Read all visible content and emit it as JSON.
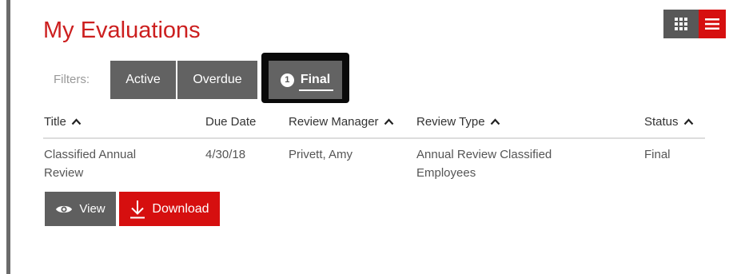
{
  "header": {
    "title": "My Evaluations"
  },
  "filters": {
    "label": "Filters:",
    "tabs": [
      {
        "label": "Active"
      },
      {
        "label": "Overdue"
      },
      {
        "label": "Final",
        "count": "1",
        "selected": true
      }
    ]
  },
  "table": {
    "columns": [
      {
        "label": "Title",
        "sortable": true
      },
      {
        "label": "Due Date",
        "sortable": false
      },
      {
        "label": "Review Manager",
        "sortable": true
      },
      {
        "label": "Review Type",
        "sortable": true
      },
      {
        "label": "Status",
        "sortable": true
      }
    ],
    "rows": [
      {
        "title": "Classified Annual Review",
        "due_date": "4/30/18",
        "review_manager": "Privett, Amy",
        "review_type": "Annual Review Classified Employees",
        "status": "Final"
      }
    ]
  },
  "actions": {
    "view_label": "View",
    "download_label": "Download"
  },
  "colors": {
    "accent_red": "#d60f0f",
    "title_red": "#cc1f1f",
    "tab_gray": "#626262",
    "highlight_frame": "#0a0a0a"
  },
  "icons": {
    "grid": "grid-icon",
    "menu": "hamburger-icon",
    "view": "eye-icon",
    "download": "download-icon",
    "sort": "caret-up-icon"
  }
}
